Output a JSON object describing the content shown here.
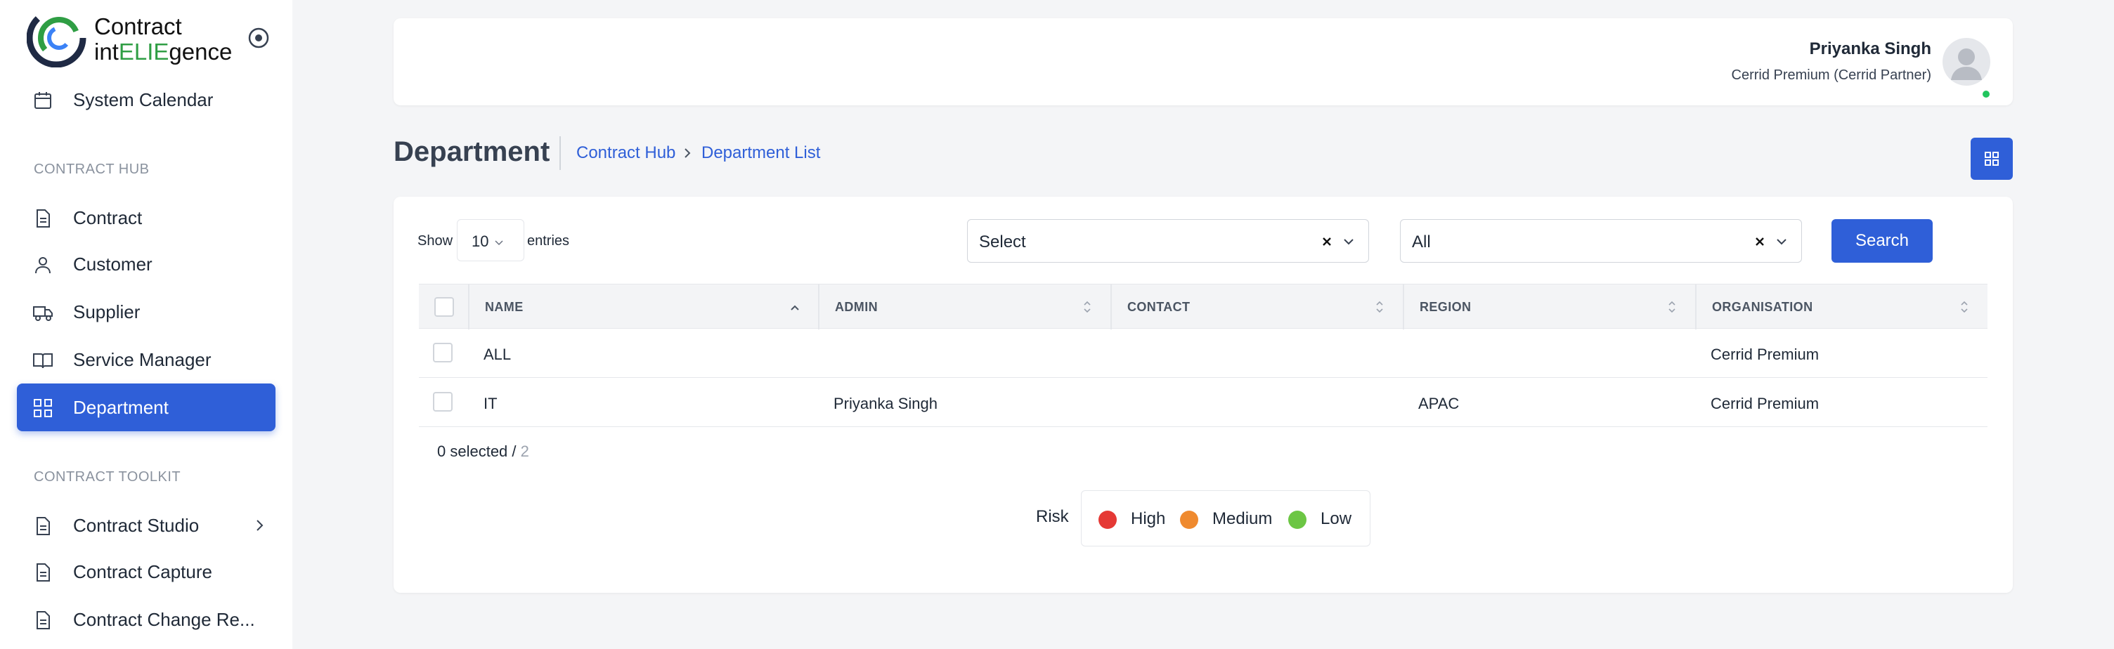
{
  "brand": {
    "line1": "Contract",
    "line2_pre": "int",
    "line2_eli": "ELIE",
    "line2_post": "gence",
    "accent": "#2f5fd8"
  },
  "sidebar": {
    "top_item": {
      "label": "System Calendar",
      "icon": "calendar-icon"
    },
    "section_hub": "CONTRACT HUB",
    "hub_items": [
      {
        "label": "Contract",
        "icon": "document-icon"
      },
      {
        "label": "Customer",
        "icon": "user-icon"
      },
      {
        "label": "Supplier",
        "icon": "truck-icon"
      },
      {
        "label": "Service Manager",
        "icon": "book-icon"
      },
      {
        "label": "Department",
        "icon": "grid-icon",
        "active": true
      }
    ],
    "section_toolkit": "CONTRACT TOOLKIT",
    "toolkit_items": [
      {
        "label": "Contract Studio",
        "icon": "document-icon"
      },
      {
        "label": "Contract Capture",
        "icon": "document-icon"
      },
      {
        "label": "Contract Change Re...",
        "icon": "document-icon"
      }
    ]
  },
  "user": {
    "name": "Priyanka Singh",
    "org": "Cerrid Premium (Cerrid Partner)",
    "status_color": "#22c55e"
  },
  "page": {
    "title": "Department",
    "breadcrumb": [
      "Contract Hub",
      "Department List"
    ]
  },
  "filters": {
    "show_label": "Show",
    "entries_value": "10",
    "entries_label": "entries",
    "select1_value": "Select",
    "select2_value": "All",
    "search_label": "Search"
  },
  "table": {
    "columns": [
      "NAME",
      "ADMIN",
      "CONTACT",
      "REGION",
      "ORGANISATION"
    ],
    "rows": [
      {
        "name": "ALL",
        "admin": "",
        "contact": "",
        "region": "",
        "organisation": "Cerrid Premium"
      },
      {
        "name": "IT",
        "admin": "Priyanka Singh",
        "contact": "",
        "region": "APAC",
        "organisation": "Cerrid Premium"
      }
    ],
    "selected_text": "0 selected / ",
    "total": "2"
  },
  "risk": {
    "label": "Risk",
    "levels": [
      {
        "label": "High",
        "color": "#e53935"
      },
      {
        "label": "Medium",
        "color": "#ef8a2f"
      },
      {
        "label": "Low",
        "color": "#6cc644"
      }
    ]
  }
}
